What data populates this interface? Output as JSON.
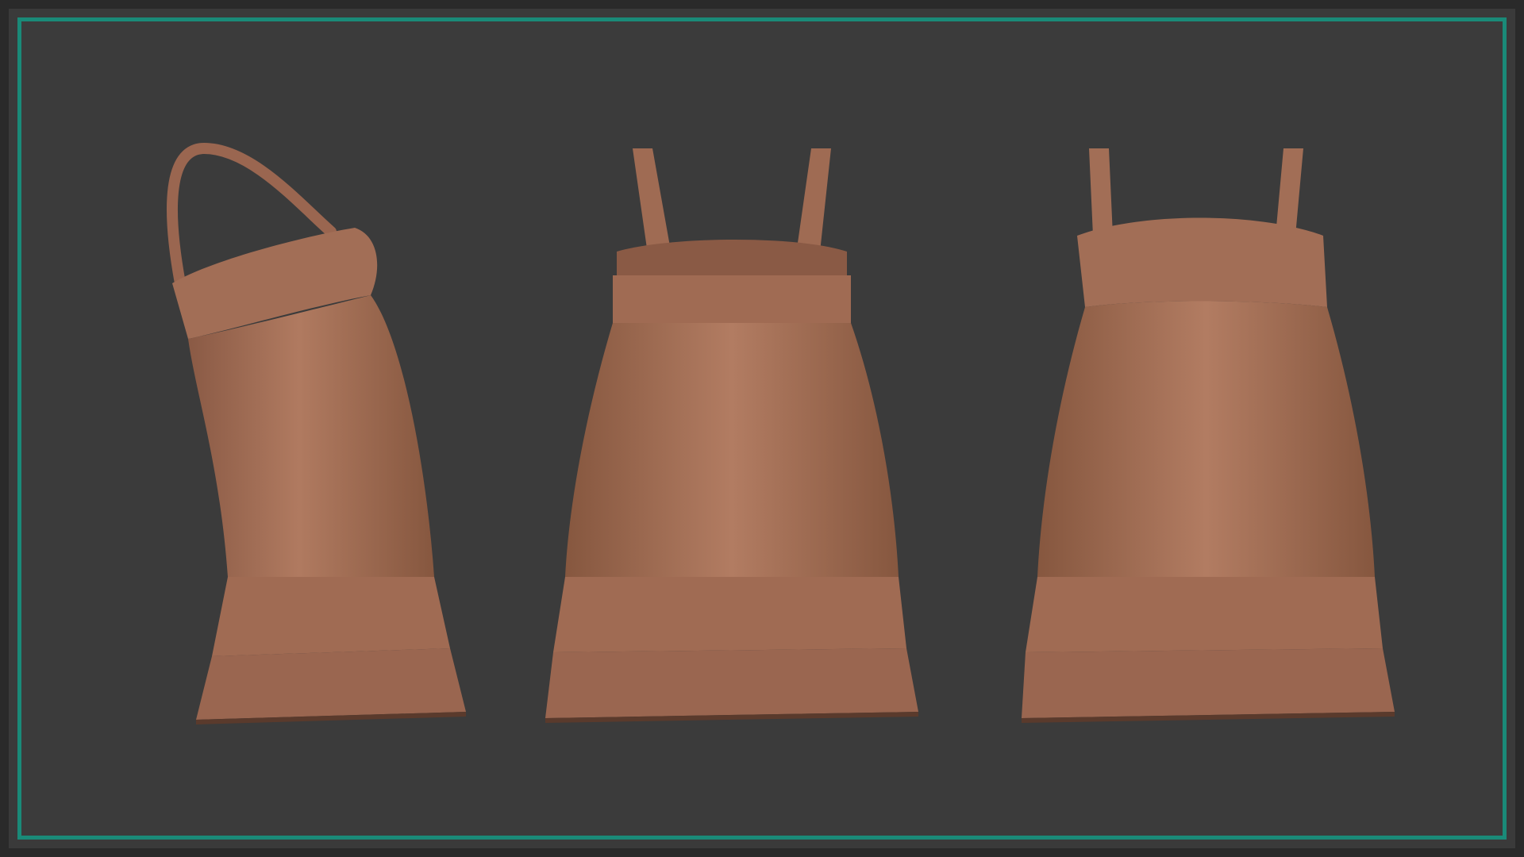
{
  "scene": {
    "background_color": "#3a3a3a",
    "border_color": "#1a8a78",
    "fabric_color": "#a8725a",
    "fabric_shadow_color": "#7a4f3c",
    "fabric_highlight_color": "#c08a70"
  },
  "views": [
    {
      "id": "side",
      "kind": "side-view"
    },
    {
      "id": "back",
      "kind": "back-view"
    },
    {
      "id": "front",
      "kind": "front-view"
    }
  ]
}
